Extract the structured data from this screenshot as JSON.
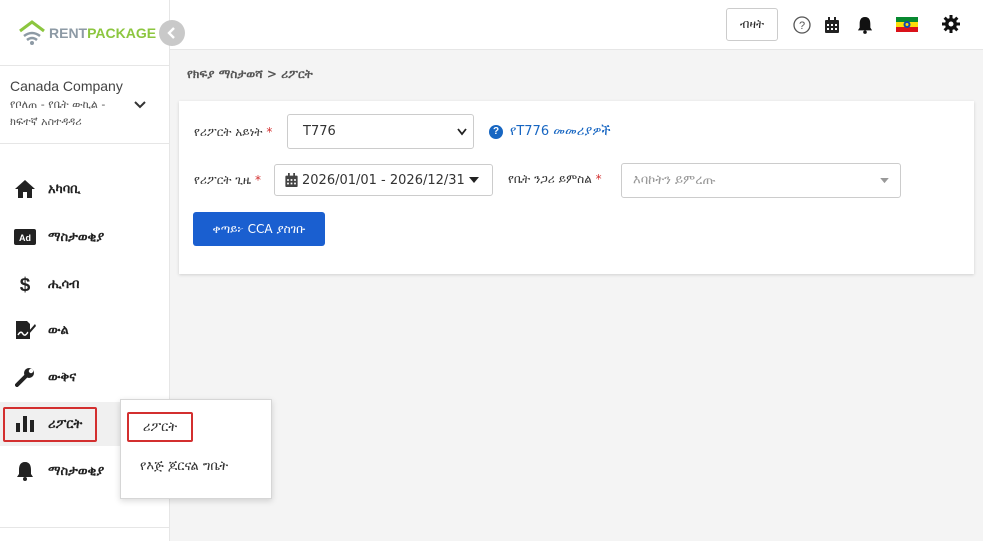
{
  "app": {
    "logo_rent": "RENT",
    "logo_package": "PACKAGE"
  },
  "sidebar": {
    "company_name": "Canada Company",
    "company_role": "የቦለጠ - የቤት ውኪል - ክፍተኛ አስተዳዳሪ",
    "items": [
      {
        "label": "አካባቢ",
        "icon": "home-icon"
      },
      {
        "label": "ማስታወቂያ",
        "icon": "ad-icon"
      },
      {
        "label": "ሒሳብ",
        "icon": "dollar-icon"
      },
      {
        "label": "ውል",
        "icon": "signature-icon"
      },
      {
        "label": "ውቅና",
        "icon": "wrench-icon"
      },
      {
        "label": "ሪፖርት",
        "icon": "bar-chart-icon"
      },
      {
        "label": "ማስታወቂያ",
        "icon": "bell-icon"
      }
    ]
  },
  "topbar": {
    "button_label": "ብዛት",
    "icons": [
      "help-icon",
      "calendar-icon",
      "bell-icon",
      "ethiopia-flag-icon",
      "gear-icon"
    ]
  },
  "breadcrumb": "የክፍያ ማስታወሻ > ሪፖርት",
  "form": {
    "report_type_label": "የሪፖርት አይነት",
    "report_type_value": "T776",
    "help_link": "የT776 መመሪያዎች",
    "report_period_label": "የሪፖርት ጊዜ",
    "report_period_value": "2026/01/01 - 2026/12/31",
    "property_label": "የቤት ንጋሪ ይምስል",
    "property_placeholder": "እባኮትን ይምረጡ",
    "required_mark": "*",
    "submit_label": "ቀጣይ፦ CCA ያስገቡ"
  },
  "reports_menu": {
    "items": [
      "ሪፖርት",
      "የእጅ ጆርናል ግቤት"
    ]
  },
  "colors": {
    "primary": "#1a5fd0",
    "highlight": "#d32f2f",
    "link": "#1766c2",
    "logo_green": "#8cc63f"
  }
}
